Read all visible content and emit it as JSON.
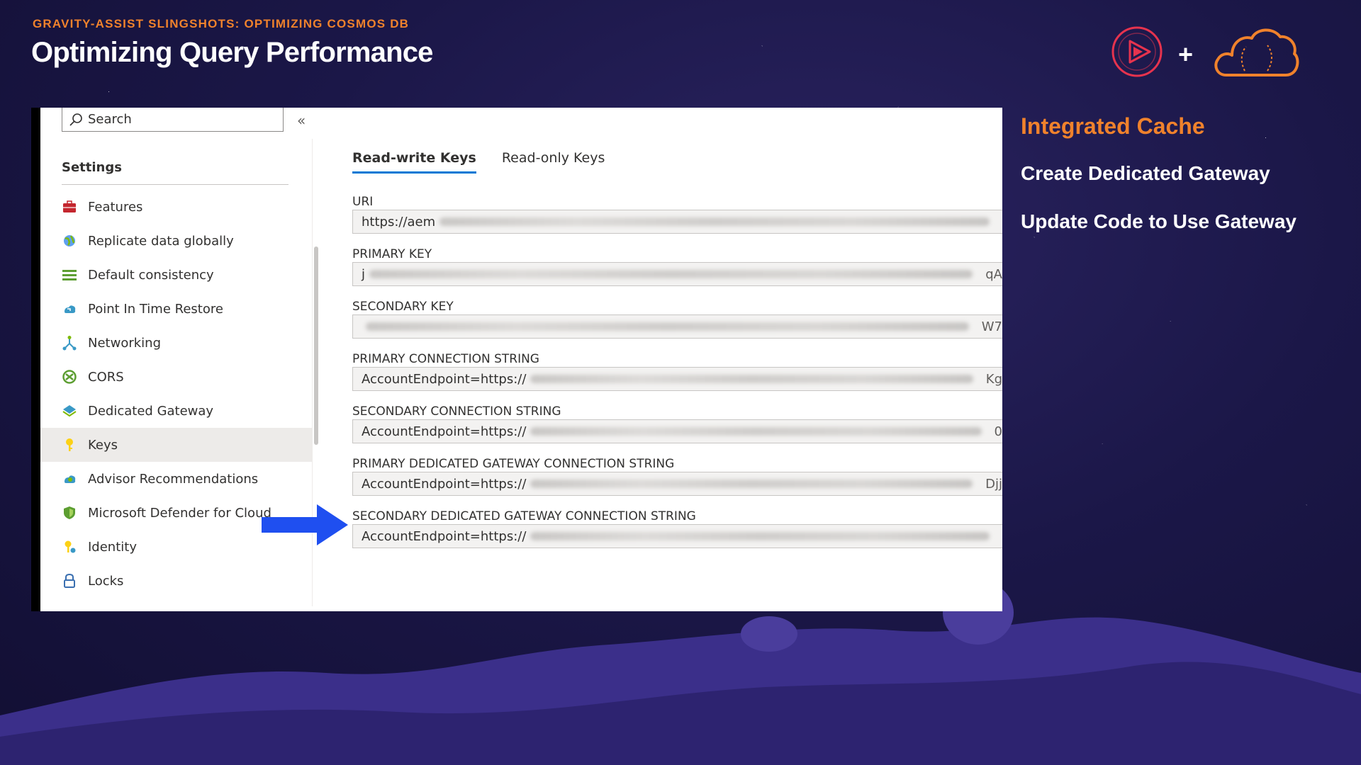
{
  "slide": {
    "eyebrow": "GRAVITY-ASSIST SLINGSHOTS: OPTIMIZING COSMOS DB",
    "title": "Optimizing Query Performance",
    "plus": "+"
  },
  "side_panel": {
    "heading": "Integrated Cache",
    "items": [
      "Create Dedicated Gateway",
      "Update Code to Use Gateway"
    ]
  },
  "portal": {
    "search": {
      "placeholder": "Search",
      "collapse_glyph": "«"
    },
    "nav_heading": "Settings",
    "nav_items": [
      {
        "label": "Features",
        "icon": "briefcase-icon"
      },
      {
        "label": "Replicate data globally",
        "icon": "globe-icon"
      },
      {
        "label": "Default consistency",
        "icon": "lines-icon"
      },
      {
        "label": "Point In Time Restore",
        "icon": "restore-icon"
      },
      {
        "label": "Networking",
        "icon": "network-icon"
      },
      {
        "label": "CORS",
        "icon": "cors-icon"
      },
      {
        "label": "Dedicated Gateway",
        "icon": "gateway-icon"
      },
      {
        "label": "Keys",
        "icon": "key-icon",
        "active": true
      },
      {
        "label": "Advisor Recommendations",
        "icon": "advisor-icon"
      },
      {
        "label": "Microsoft Defender for Cloud",
        "icon": "shield-icon"
      },
      {
        "label": "Identity",
        "icon": "identity-icon"
      },
      {
        "label": "Locks",
        "icon": "lock-icon"
      }
    ],
    "tabs": [
      {
        "label": "Read-write Keys",
        "active": true
      },
      {
        "label": "Read-only Keys",
        "active": false
      }
    ],
    "fields": [
      {
        "label": "URI",
        "value": "https://aem",
        "tail": ""
      },
      {
        "label": "PRIMARY KEY",
        "value": "j",
        "tail": "qA"
      },
      {
        "label": "SECONDARY KEY",
        "value": "",
        "tail": "W7"
      },
      {
        "label": "PRIMARY CONNECTION STRING",
        "value": "AccountEndpoint=https://",
        "tail": "Kg"
      },
      {
        "label": "SECONDARY CONNECTION STRING",
        "value": "AccountEndpoint=https://",
        "tail": "0"
      },
      {
        "label": "PRIMARY DEDICATED GATEWAY CONNECTION STRING",
        "value": "AccountEndpoint=https://",
        "tail": "Djj"
      },
      {
        "label": "SECONDARY DEDICATED GATEWAY CONNECTION STRING",
        "value": "AccountEndpoint=https://",
        "tail": ""
      }
    ]
  },
  "colors": {
    "accent_orange": "#f0822c",
    "tab_blue": "#0078d4",
    "arrow_blue": "#1f4ff0",
    "background": "#1b1748"
  }
}
